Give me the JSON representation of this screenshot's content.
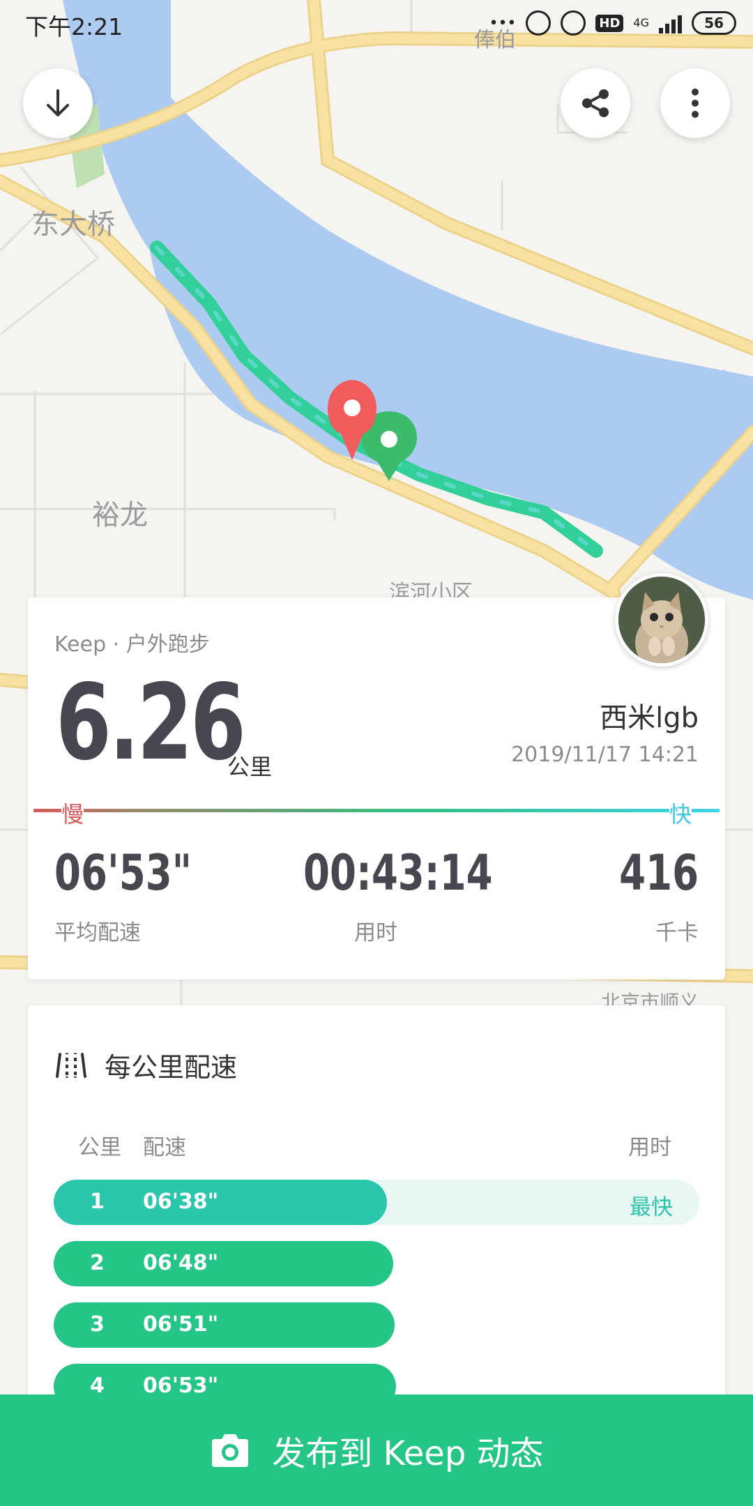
{
  "status_bar": {
    "time": "下午2:21",
    "network": "4G",
    "hd": "HD",
    "battery": "56",
    "dots": "•••"
  },
  "map": {
    "labels": {
      "dongdaqiao": "东大桥",
      "yulong": "裕龙",
      "binhe": "滨河小区",
      "fengbo": "俸伯",
      "beijing_shunyi": "北京市顺义"
    },
    "colors": {
      "land": "#f6f4f1",
      "water": "#adcbf0",
      "road": "#f7e1a3",
      "road_edge": "#ecd38c",
      "route": "#33cf9b",
      "start_pin": "#f05b5b",
      "end_pin": "#3dbb6d"
    }
  },
  "header_buttons": {
    "download": "down-arrow-icon",
    "share": "share-icon",
    "more": "more-vertical-icon"
  },
  "summary": {
    "app_label": "Keep · 户外跑步",
    "distance": "6.26",
    "distance_unit": "公里",
    "username": "西米lgb",
    "datetime": "2019/11/17 14:21",
    "pace_scale": {
      "slow": "慢",
      "fast": "快"
    },
    "stats": [
      {
        "value": "06'53\"",
        "label": "平均配速"
      },
      {
        "value": "00:43:14",
        "label": "用时"
      },
      {
        "value": "416",
        "label": "千卡"
      }
    ]
  },
  "splits": {
    "title": "每公里配速",
    "columns": {
      "km": "公里",
      "pace": "配速",
      "time": "用时"
    },
    "rows": [
      {
        "km": "1",
        "pace": "06'38\"",
        "tag": "最快",
        "fraction": 0.516,
        "color": "#2cc6ad"
      },
      {
        "km": "2",
        "pace": "06'48\"",
        "tag": "",
        "fraction": 0.526,
        "color": "#25c487"
      },
      {
        "km": "3",
        "pace": "06'51\"",
        "tag": "",
        "fraction": 0.528,
        "color": "#25c487"
      },
      {
        "km": "4",
        "pace": "06'53\"",
        "tag": "",
        "fraction": 0.53,
        "color": "#25c487"
      }
    ]
  },
  "bottom_action": {
    "label": "发布到 Keep 动态",
    "icon": "camera-icon"
  }
}
